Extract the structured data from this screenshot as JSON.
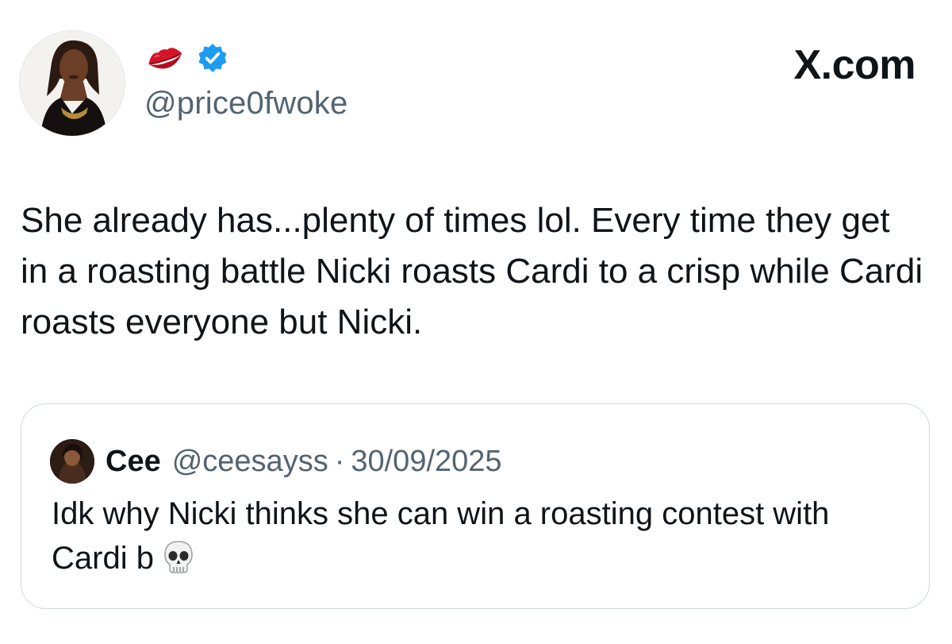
{
  "site_label": "X.com",
  "post": {
    "author_handle": "@price0fwoke",
    "author_avatar_icon": "profile-photo",
    "name_emoji_icon": "lips-icon",
    "verified_icon": "verified-badge-icon",
    "text": "She already has...plenty of times lol. Every time they get in a roasting battle Nicki roasts Cardi to a crisp while Cardi roasts everyone but Nicki."
  },
  "quoted_post": {
    "author_name": "Cee",
    "author_handle": "@ceesayss",
    "separator": "·",
    "date": "30/09/2025",
    "text": "Idk why Nicki thinks she can win a roasting contest with Cardi b",
    "emoji_icon": "skull-icon"
  },
  "colors": {
    "text_primary": "#0f1419",
    "text_secondary": "#536471",
    "verified_blue": "#1d9bf0",
    "card_border": "#cfd9de",
    "lips_red": "#d4142a"
  }
}
